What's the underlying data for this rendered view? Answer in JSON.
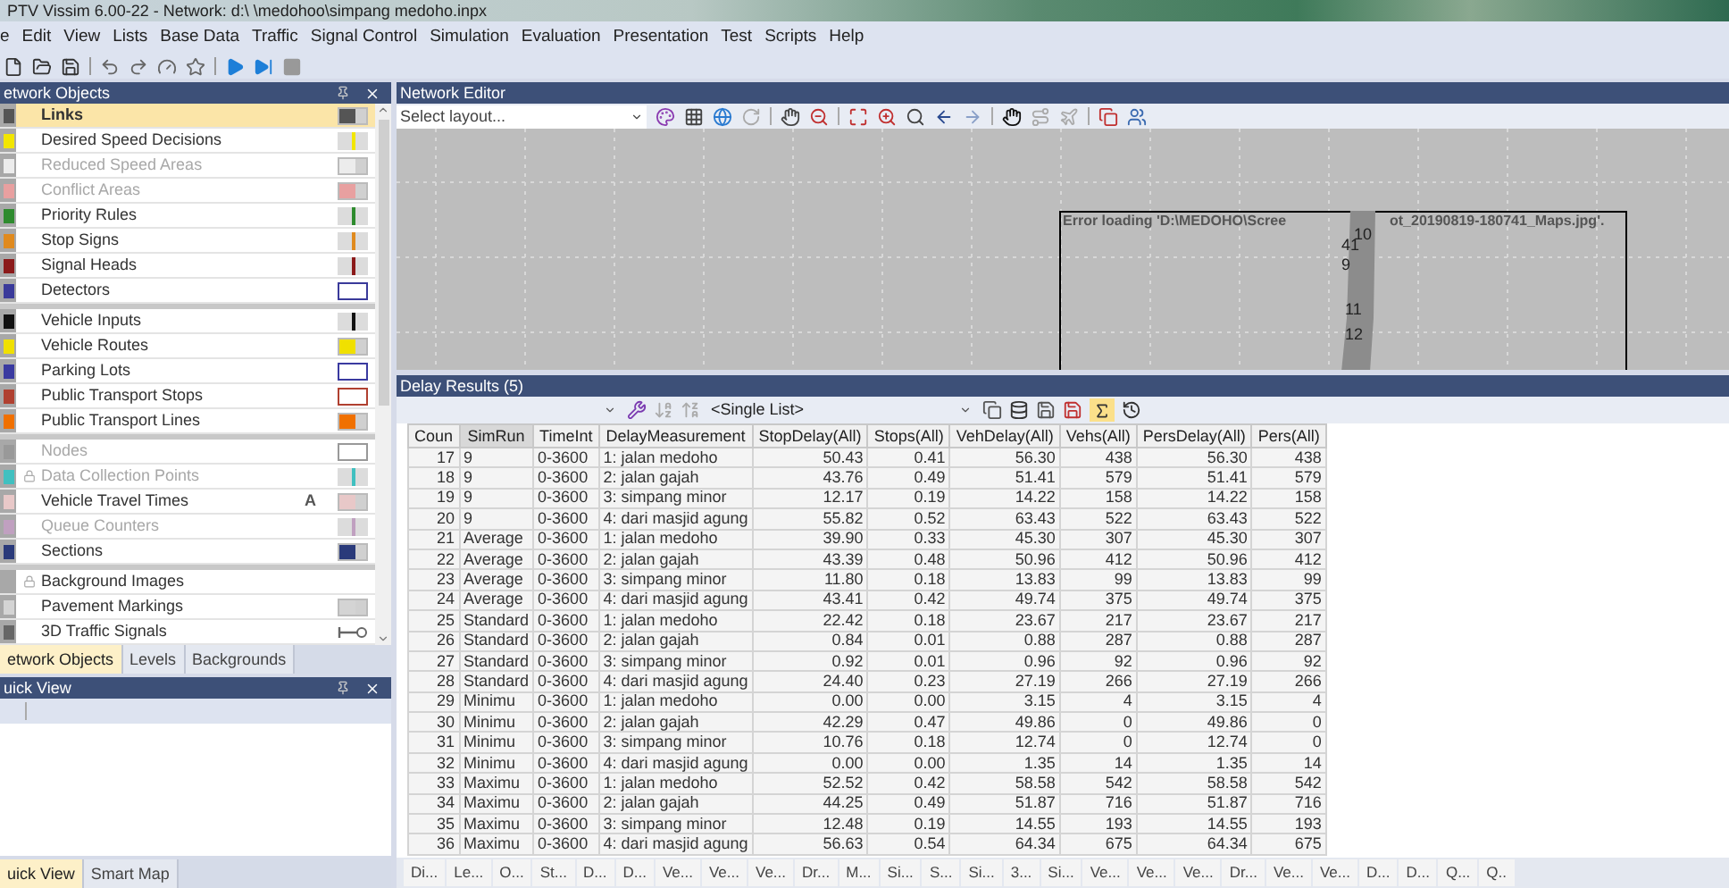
{
  "window": {
    "title": "PTV Vissim 6.00-22 - Network: d:\\ \\medohoo\\simpang medoho.inpx"
  },
  "menu": [
    "e",
    "Edit",
    "View",
    "Lists",
    "Base Data",
    "Traffic",
    "Signal Control",
    "Simulation",
    "Evaluation",
    "Presentation",
    "Test",
    "Scripts",
    "Help"
  ],
  "network_objects": {
    "title": "etwork Objects",
    "groups": [
      {
        "items": [
          {
            "label": "Links",
            "selected": true,
            "disabled": false,
            "locked": false,
            "swatch": {
              "kind": "fill",
              "color": "#555555"
            }
          },
          {
            "label": "Desired Speed Decisions",
            "selected": false,
            "disabled": false,
            "locked": false,
            "swatch": {
              "kind": "line",
              "color": "#f2e600"
            }
          },
          {
            "label": "Reduced Speed Areas",
            "selected": false,
            "disabled": true,
            "locked": false,
            "swatch": {
              "kind": "fill",
              "color": "#ececec"
            }
          },
          {
            "label": "Conflict Areas",
            "selected": false,
            "disabled": true,
            "locked": false,
            "swatch": {
              "kind": "fill",
              "color": "#e8a0a0"
            }
          },
          {
            "label": "Priority Rules",
            "selected": false,
            "disabled": false,
            "locked": false,
            "swatch": {
              "kind": "line",
              "color": "#2e8b2e"
            }
          },
          {
            "label": "Stop Signs",
            "selected": false,
            "disabled": false,
            "locked": false,
            "swatch": {
              "kind": "line",
              "color": "#e08a1e"
            }
          },
          {
            "label": "Signal Heads",
            "selected": false,
            "disabled": false,
            "locked": false,
            "swatch": {
              "kind": "line",
              "color": "#8b1a1a"
            }
          },
          {
            "label": "Detectors",
            "selected": false,
            "disabled": false,
            "locked": false,
            "swatch": {
              "kind": "outline",
              "color": "#3a3a9a"
            }
          }
        ]
      },
      {
        "items": [
          {
            "label": "Vehicle Inputs",
            "selected": false,
            "disabled": false,
            "locked": false,
            "swatch": {
              "kind": "line",
              "color": "#111111"
            }
          },
          {
            "label": "Vehicle Routes",
            "selected": false,
            "disabled": false,
            "locked": false,
            "swatch": {
              "kind": "fill",
              "color": "#f0e000"
            }
          },
          {
            "label": "Parking Lots",
            "selected": false,
            "disabled": false,
            "locked": false,
            "swatch": {
              "kind": "outline",
              "color": "#3a3aa0"
            }
          },
          {
            "label": "Public Transport Stops",
            "selected": false,
            "disabled": false,
            "locked": false,
            "swatch": {
              "kind": "outline",
              "color": "#b04030"
            }
          },
          {
            "label": "Public Transport Lines",
            "selected": false,
            "disabled": false,
            "locked": false,
            "swatch": {
              "kind": "fill",
              "color": "#f07000"
            }
          }
        ]
      },
      {
        "items": [
          {
            "label": "Nodes",
            "selected": false,
            "disabled": true,
            "locked": false,
            "swatch": {
              "kind": "outline",
              "color": "#999999"
            }
          },
          {
            "label": "Data Collection Points",
            "selected": false,
            "disabled": true,
            "locked": true,
            "swatch": {
              "kind": "line",
              "color": "#40c0c0"
            }
          },
          {
            "label": "Vehicle Travel Times",
            "selected": false,
            "disabled": false,
            "locked": false,
            "badge": "A",
            "swatch": {
              "kind": "fill",
              "color": "#e8c8c8"
            }
          },
          {
            "label": "Queue Counters",
            "selected": false,
            "disabled": true,
            "locked": false,
            "swatch": {
              "kind": "line",
              "color": "#c0a0c0"
            }
          },
          {
            "label": "Sections",
            "selected": false,
            "disabled": false,
            "locked": false,
            "swatch": {
              "kind": "fill",
              "color": "#2a3a7a"
            }
          }
        ]
      },
      {
        "items": [
          {
            "label": "Background Images",
            "selected": false,
            "disabled": false,
            "locked": true
          },
          {
            "label": "Pavement Markings",
            "selected": false,
            "disabled": false,
            "locked": false,
            "swatch": {
              "kind": "fill",
              "color": "#d4d4d4"
            }
          },
          {
            "label": "3D Traffic Signals",
            "selected": false,
            "disabled": false,
            "locked": false,
            "swatch": {
              "kind": "signal",
              "color": "#666666"
            }
          }
        ]
      }
    ],
    "tabs": [
      {
        "label": "etwork Objects",
        "selected": true
      },
      {
        "label": "Levels",
        "selected": false
      },
      {
        "label": "Backgrounds",
        "selected": false
      }
    ]
  },
  "quick_view": {
    "title": "uick View",
    "tabs": [
      {
        "label": "uick View",
        "selected": true
      },
      {
        "label": "Smart Map",
        "selected": false
      }
    ]
  },
  "network_editor": {
    "title": "Network Editor",
    "layout_select": "Select layout...",
    "error_text": [
      "Error loading 'D:\\MEDOHO\\Scree",
      "ot_20190819-180741_Maps.jpg'."
    ],
    "node_labels": [
      "10",
      "41",
      "9",
      "11",
      "12"
    ]
  },
  "delay_results": {
    "title": "Delay Results (5)",
    "list_select": "<Single List>",
    "sum_on": true,
    "table": {
      "columns": [
        "Coun",
        "SimRun",
        "TimeInt",
        "DelayMeasurement",
        "StopDelay(All)",
        "Stops(All)",
        "VehDelay(All)",
        "Vehs(All)",
        "PersDelay(All)",
        "Pers(All)"
      ],
      "rows": [
        [
          "17",
          "9",
          "0-3600",
          "1: jalan medoho",
          "50.43",
          "0.41",
          "56.30",
          "438",
          "56.30",
          "438"
        ],
        [
          "18",
          "9",
          "0-3600",
          "2: jalan gajah",
          "43.76",
          "0.49",
          "51.41",
          "579",
          "51.41",
          "579"
        ],
        [
          "19",
          "9",
          "0-3600",
          "3: simpang minor",
          "12.17",
          "0.19",
          "14.22",
          "158",
          "14.22",
          "158"
        ],
        [
          "20",
          "9",
          "0-3600",
          "4: dari masjid agung",
          "55.82",
          "0.52",
          "63.43",
          "522",
          "63.43",
          "522"
        ],
        [
          "21",
          "Average",
          "0-3600",
          "1: jalan medoho",
          "39.90",
          "0.33",
          "45.30",
          "307",
          "45.30",
          "307"
        ],
        [
          "22",
          "Average",
          "0-3600",
          "2: jalan gajah",
          "43.39",
          "0.48",
          "50.96",
          "412",
          "50.96",
          "412"
        ],
        [
          "23",
          "Average",
          "0-3600",
          "3: simpang minor",
          "11.80",
          "0.18",
          "13.83",
          "99",
          "13.83",
          "99"
        ],
        [
          "24",
          "Average",
          "0-3600",
          "4: dari masjid agung",
          "43.41",
          "0.42",
          "49.74",
          "375",
          "49.74",
          "375"
        ],
        [
          "25",
          "Standard",
          "0-3600",
          "1: jalan medoho",
          "22.42",
          "0.18",
          "23.67",
          "217",
          "23.67",
          "217"
        ],
        [
          "26",
          "Standard",
          "0-3600",
          "2: jalan gajah",
          "0.84",
          "0.01",
          "0.88",
          "287",
          "0.88",
          "287"
        ],
        [
          "27",
          "Standard",
          "0-3600",
          "3: simpang minor",
          "0.92",
          "0.01",
          "0.96",
          "92",
          "0.96",
          "92"
        ],
        [
          "28",
          "Standard",
          "0-3600",
          "4: dari masjid agung",
          "24.40",
          "0.23",
          "27.19",
          "266",
          "27.19",
          "266"
        ],
        [
          "29",
          "Minimu",
          "0-3600",
          "1: jalan medoho",
          "0.00",
          "0.00",
          "3.15",
          "4",
          "3.15",
          "4"
        ],
        [
          "30",
          "Minimu",
          "0-3600",
          "2: jalan gajah",
          "42.29",
          "0.47",
          "49.86",
          "0",
          "49.86",
          "0"
        ],
        [
          "31",
          "Minimu",
          "0-3600",
          "3: simpang minor",
          "10.76",
          "0.18",
          "12.74",
          "0",
          "12.74",
          "0"
        ],
        [
          "32",
          "Minimu",
          "0-3600",
          "4: dari masjid agung",
          "0.00",
          "0.00",
          "1.35",
          "14",
          "1.35",
          "14"
        ],
        [
          "33",
          "Maximu",
          "0-3600",
          "1: jalan medoho",
          "52.52",
          "0.42",
          "58.58",
          "542",
          "58.58",
          "542"
        ],
        [
          "34",
          "Maximu",
          "0-3600",
          "2: jalan gajah",
          "44.25",
          "0.49",
          "51.87",
          "716",
          "51.87",
          "716"
        ],
        [
          "35",
          "Maximu",
          "0-3600",
          "3: simpang minor",
          "12.48",
          "0.19",
          "14.55",
          "193",
          "14.55",
          "193"
        ],
        [
          "36",
          "Maximu",
          "0-3600",
          "4: dari masjid agung",
          "56.63",
          "0.54",
          "64.34",
          "675",
          "64.34",
          "675"
        ]
      ]
    },
    "bottom_tabs": [
      "Di...",
      "Le...",
      "O...",
      "St...",
      "D...",
      "D...",
      "Ve...",
      "Ve...",
      "Ve...",
      "Dr...",
      "M...",
      "Si...",
      "S...",
      "Si...",
      "3...",
      "Si...",
      "Ve...",
      "Ve...",
      "Ve...",
      "Dr...",
      "Ve...",
      "Ve...",
      "D...",
      "D...",
      "Q...",
      "Q.."
    ]
  }
}
